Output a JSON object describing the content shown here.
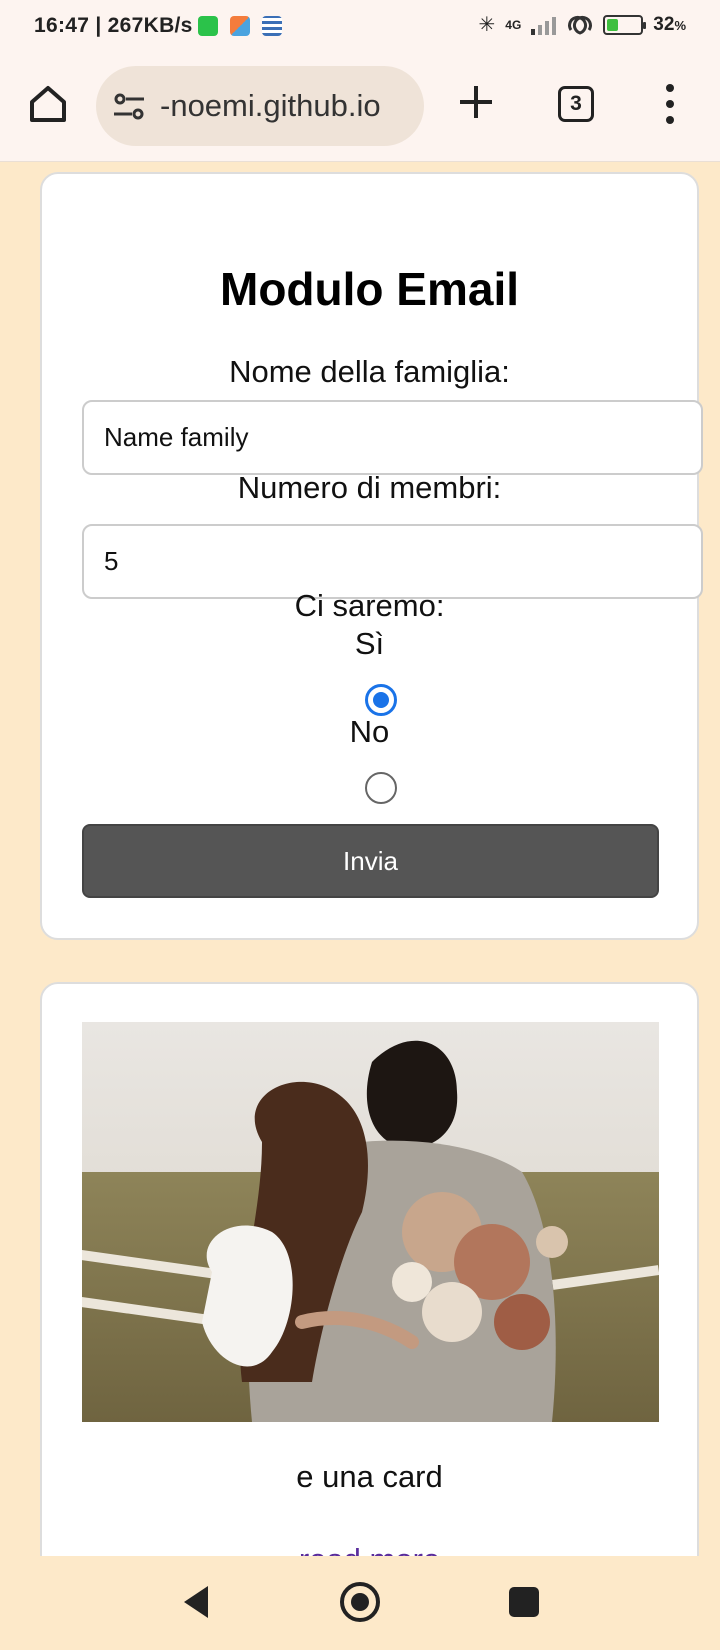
{
  "status_bar": {
    "time": "16:47",
    "speed": "267KB/s",
    "network": "4G",
    "battery": "32",
    "battery_unit": "%",
    "battery_level": 0.32
  },
  "browser": {
    "url": "​-noemi.github.io",
    "tab_count": "3"
  },
  "form": {
    "title": "Modulo Email",
    "family_label": "Nome della famiglia:",
    "family_value": "Name family",
    "members_label": "Numero di membri:",
    "members_value": "5",
    "attendance_label": "Ci saremo:",
    "option_yes": "Sì",
    "option_no": "No",
    "selected": "yes",
    "submit_label": "Invia"
  },
  "card": {
    "text": "e una card",
    "link": "read more"
  },
  "colors": {
    "page_background": "#fde9c9",
    "accent": "#1a73e8",
    "button": "#555555",
    "link": "#5a2d9c"
  }
}
